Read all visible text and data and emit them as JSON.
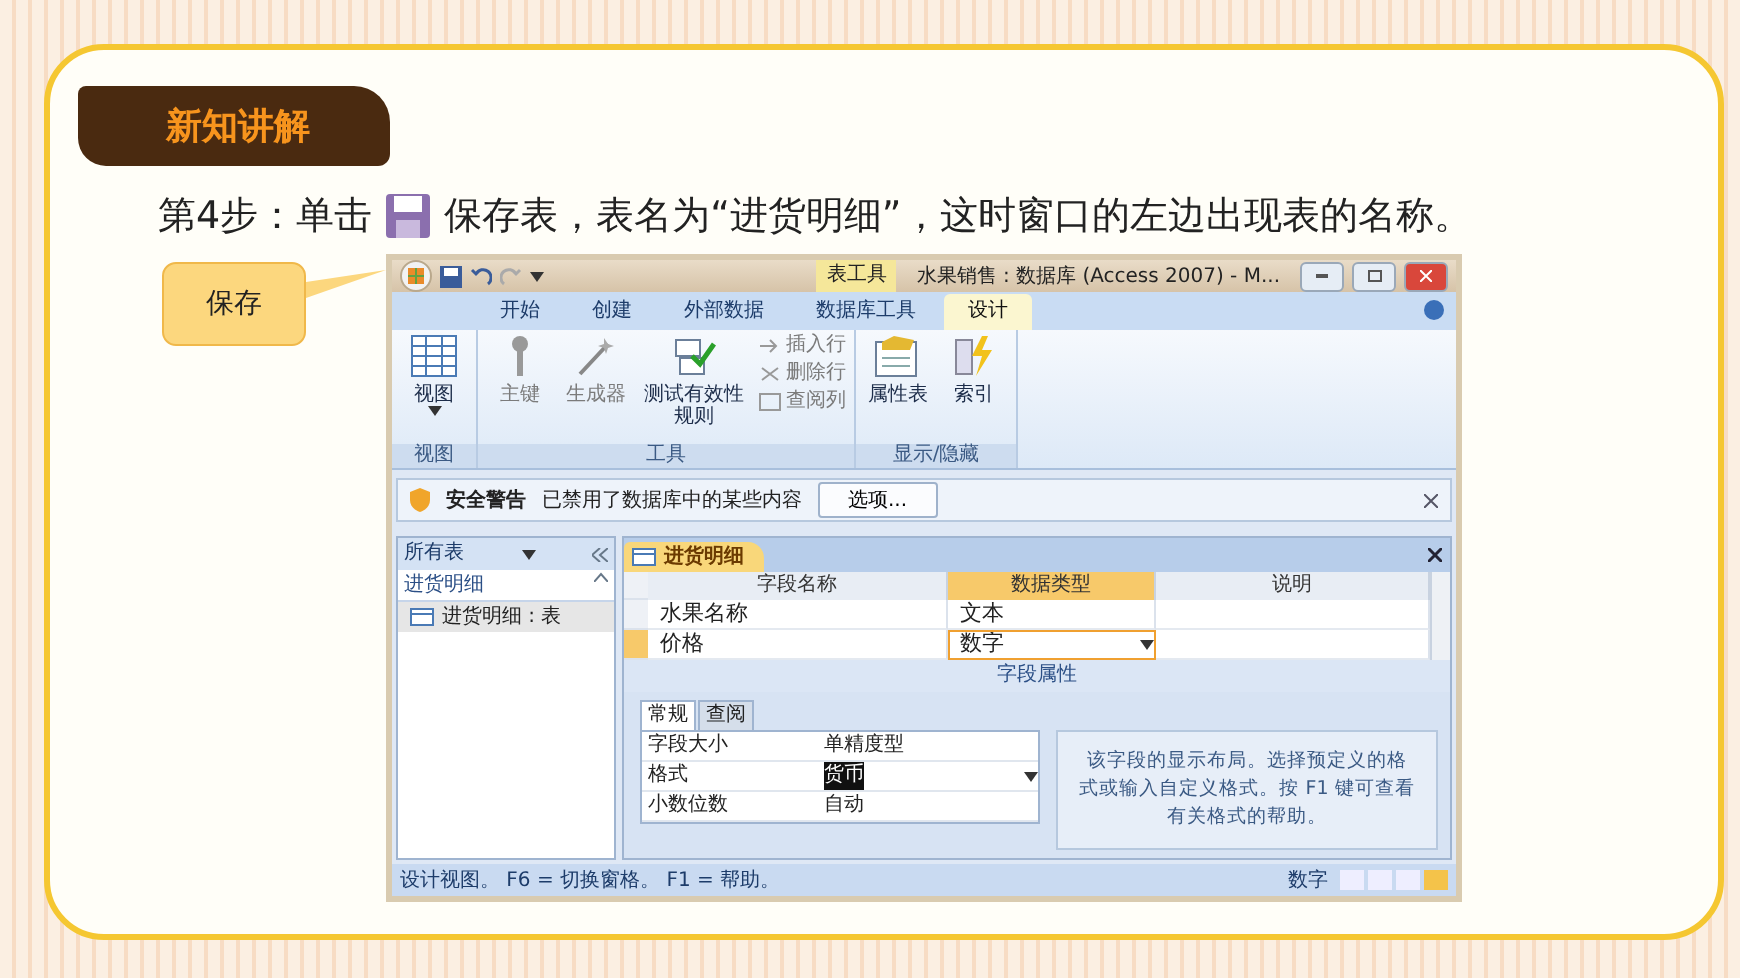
{
  "slide": {
    "section_badge": "新知讲解",
    "instruction": {
      "before": "第4步：单击",
      "after": "保存表，表名为“进货明细”，这时窗口的左边出现表的名称。"
    },
    "callout": "保存"
  },
  "window": {
    "context_tab": "表工具",
    "title": "水果销售 : 数据库 (Access 2007) - M...",
    "ribbon_tabs": [
      {
        "label": "开始",
        "selected": false
      },
      {
        "label": "创建",
        "selected": false
      },
      {
        "label": "外部数据",
        "selected": false
      },
      {
        "label": "数据库工具",
        "selected": false
      },
      {
        "label": "设计",
        "selected": true
      }
    ],
    "ribbon_groups": [
      {
        "label": "视图",
        "buttons": [
          {
            "kind": "large",
            "label": "视图",
            "dropdown": true,
            "disabled": false
          }
        ]
      },
      {
        "label": "工具",
        "buttons": [
          {
            "kind": "large",
            "label": "主键",
            "disabled": true
          },
          {
            "kind": "large",
            "label": "生成器",
            "disabled": true
          },
          {
            "kind": "large",
            "label": "测试有效性规则",
            "disabled": false
          },
          {
            "kind": "small",
            "label": "插入行",
            "disabled": true
          },
          {
            "kind": "small",
            "label": "删除行",
            "disabled": true
          },
          {
            "kind": "small",
            "label": "查阅列",
            "disabled": true
          }
        ]
      },
      {
        "label": "显示/隐藏",
        "buttons": [
          {
            "kind": "large",
            "label": "属性表",
            "disabled": false
          },
          {
            "kind": "large",
            "label": "索引",
            "disabled": false
          }
        ]
      }
    ],
    "security_bar": {
      "title": "安全警告",
      "message": "已禁用了数据库中的某些内容",
      "button": "选项..."
    },
    "nav_pane": {
      "header": "所有表",
      "groups": [
        {
          "label": "进货明细",
          "expanded": true,
          "children": [
            {
              "label": "进货明细 : 表",
              "selected": true
            }
          ]
        }
      ]
    },
    "document_tab": "进货明细",
    "grid": {
      "columns": [
        "字段名称",
        "数据类型",
        "说明"
      ],
      "rows": [
        {
          "field": "水果名称",
          "type": "文本",
          "selected": false
        },
        {
          "field": "价格",
          "type": "数字",
          "selected": true
        }
      ]
    },
    "field_properties": {
      "title": "字段属性",
      "tabs": [
        {
          "label": "常规",
          "selected": true
        },
        {
          "label": "查阅",
          "selected": false
        }
      ],
      "rows": [
        {
          "name": "字段大小",
          "value": "单精度型",
          "selected": false
        },
        {
          "name": "格式",
          "value": "货币",
          "selected": true
        },
        {
          "name": "小数位数",
          "value": "自动",
          "selected": false
        }
      ],
      "help": "该字段的显示布局。选择预定义的格式或输入自定义格式。按 F1 键可查看有关格式的帮助。"
    },
    "status_bar": {
      "message": "设计视图。 F6 = 切换窗格。 F1 = 帮助。",
      "mode": "数字"
    }
  }
}
